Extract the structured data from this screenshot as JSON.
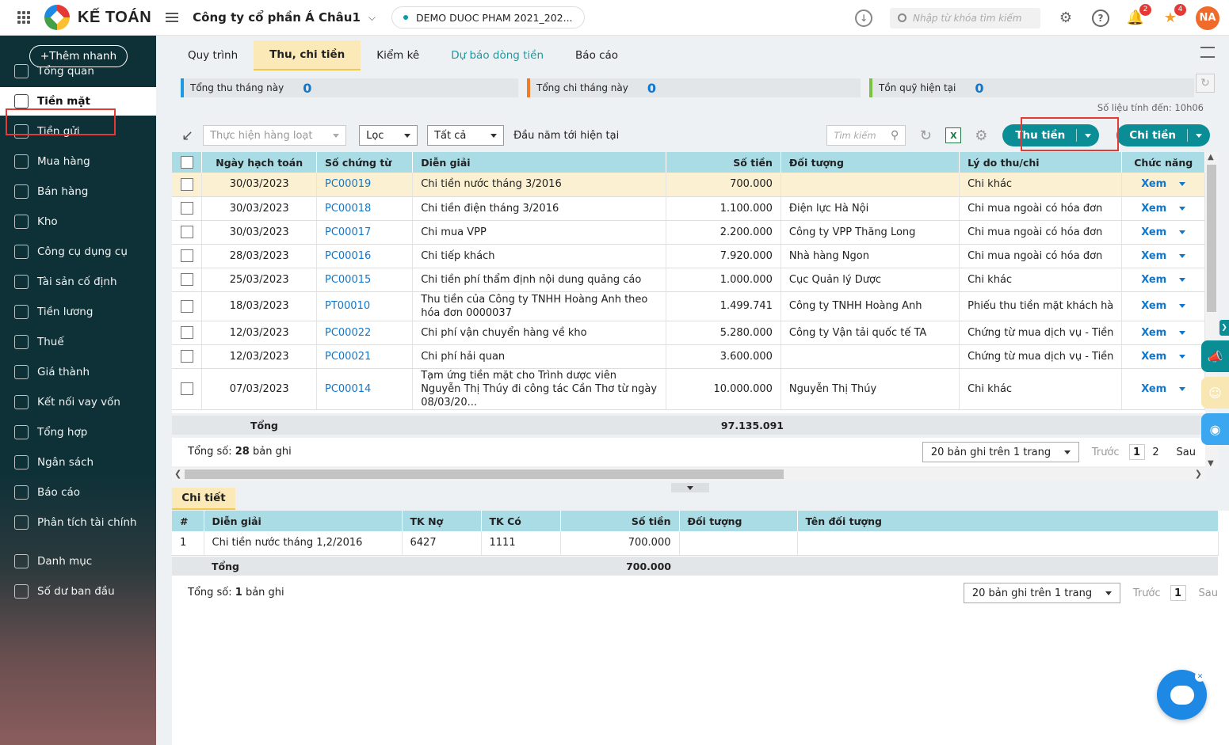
{
  "topbar": {
    "brand": "KẾ TOÁN",
    "company": "Công ty cổ phần Á Châu1",
    "database": "DEMO DUOC PHAM 2021_202...",
    "search_placeholder": "Nhập từ khóa tìm kiếm",
    "notif_count": "2",
    "alert_count": "4",
    "avatar": "NA"
  },
  "sidebar": {
    "quick_add": "Thêm nhanh",
    "items": [
      {
        "label": "Tổng quan",
        "icon": "dashboard-icon"
      },
      {
        "label": "Tiền mặt",
        "icon": "cash-bag-icon"
      },
      {
        "label": "Tiền gửi",
        "icon": "bank-icon"
      },
      {
        "label": "Mua hàng",
        "icon": "shopping-bag-icon"
      },
      {
        "label": "Bán hàng",
        "icon": "cart-icon"
      },
      {
        "label": "Kho",
        "icon": "warehouse-icon"
      },
      {
        "label": "Công cụ dụng cụ",
        "icon": "tools-icon"
      },
      {
        "label": "Tài sản cố định",
        "icon": "car-icon"
      },
      {
        "label": "Tiền lương",
        "icon": "payroll-icon"
      },
      {
        "label": "Thuế",
        "icon": "tax-building-icon"
      },
      {
        "label": "Giá thành",
        "icon": "price-tag-icon"
      },
      {
        "label": "Kết nối vay vốn",
        "icon": "loan-link-icon"
      },
      {
        "label": "Tổng hợp",
        "icon": "summary-icon"
      },
      {
        "label": "Ngân sách",
        "icon": "budget-icon"
      },
      {
        "label": "Báo cáo",
        "icon": "bar-chart-icon"
      },
      {
        "label": "Phân tích tài chính",
        "icon": "analytics-icon"
      },
      {
        "label": "Danh mục",
        "icon": "list-icon"
      },
      {
        "label": "Số dư ban đầu",
        "icon": "opening-balance-icon"
      }
    ]
  },
  "tabs": [
    "Quy trình",
    "Thu, chi tiền",
    "Kiểm kê",
    "Dự báo dòng tiền",
    "Báo cáo"
  ],
  "kpis": [
    {
      "label": "Tổng thu tháng này",
      "value": "0",
      "color": "#1e9be0"
    },
    {
      "label": "Tổng chi tháng này",
      "value": "0",
      "color": "#f07c2a"
    },
    {
      "label": "Tồn quỹ hiện tại",
      "value": "0",
      "color": "#7cc242"
    }
  ],
  "sync_text": "Số liệu tính đến: 10h06",
  "toolbar": {
    "batch": "Thực hiện hàng loạt",
    "filter": "Lọc",
    "scope": "Tất cả",
    "period": "Đầu năm tới hiện tại",
    "search_placeholder": "Tìm kiếm",
    "receive_btn": "Thu tiền",
    "pay_btn": "Chi tiền"
  },
  "table": {
    "headers": [
      "Ngày hạch toán",
      "Số chứng từ",
      "Diễn giải",
      "Số tiền",
      "Đối tượng",
      "Lý do thu/chi",
      "Chức năng"
    ],
    "rows": [
      {
        "date": "30/03/2023",
        "doc": "PC00019",
        "desc": "Chi tiền nước tháng 3/2016",
        "amount": "700.000",
        "party": "",
        "reason": "Chi khác",
        "action": "Xem"
      },
      {
        "date": "30/03/2023",
        "doc": "PC00018",
        "desc": "Chi tiền điện tháng 3/2016",
        "amount": "1.100.000",
        "party": "Điện lực Hà Nội",
        "reason": "Chi mua ngoài có hóa đơn",
        "action": "Xem"
      },
      {
        "date": "30/03/2023",
        "doc": "PC00017",
        "desc": "Chi mua VPP",
        "amount": "2.200.000",
        "party": "Công ty VPP Thăng Long",
        "reason": "Chi mua ngoài có hóa đơn",
        "action": "Xem"
      },
      {
        "date": "28/03/2023",
        "doc": "PC00016",
        "desc": "Chi tiếp khách",
        "amount": "7.920.000",
        "party": "Nhà hàng Ngon",
        "reason": "Chi mua ngoài có hóa đơn",
        "action": "Xem"
      },
      {
        "date": "25/03/2023",
        "doc": "PC00015",
        "desc": "Chi tiền phí thẩm định nội dung quảng cáo",
        "amount": "1.000.000",
        "party": "Cục Quản lý Dược",
        "reason": "Chi khác",
        "action": "Xem"
      },
      {
        "date": "18/03/2023",
        "doc": "PT00010",
        "desc": "Thu tiền của Công ty TNHH Hoàng Anh theo hóa đơn 0000037",
        "amount": "1.499.741",
        "party": "Công ty TNHH Hoàng Anh",
        "reason": "Phiếu thu tiền mặt khách hà",
        "action": "Xem"
      },
      {
        "date": "12/03/2023",
        "doc": "PC00022",
        "desc": "Chi phí vận chuyển hàng về kho",
        "amount": "5.280.000",
        "party": "Công ty Vận tải quốc tế TA",
        "reason": "Chứng từ mua dịch vụ - Tiền",
        "action": "Xem"
      },
      {
        "date": "12/03/2023",
        "doc": "PC00021",
        "desc": "Chi phí hải quan",
        "amount": "3.600.000",
        "party": "",
        "reason": "Chứng từ mua dịch vụ - Tiền",
        "action": "Xem"
      },
      {
        "date": "07/03/2023",
        "doc": "PC00014",
        "desc": "Tạm ứng tiền mặt cho Trình dược viên Nguyễn Thị Thúy đi công tác Cần Thơ từ ngày 08/03/20...",
        "amount": "10.000.000",
        "party": "Nguyễn Thị Thúy",
        "reason": "Chi khác",
        "action": "Xem"
      }
    ],
    "total_label": "Tổng",
    "total_amount": "97.135.091"
  },
  "pager": {
    "count_prefix": "Tổng số:",
    "count": "28",
    "count_suffix": "bản ghi",
    "page_size": "20 bản ghi trên 1 trang",
    "prev": "Trước",
    "page1": "1",
    "page2": "2",
    "next": "Sau"
  },
  "detail": {
    "tab": "Chi tiết",
    "headers": [
      "#",
      "Diễn giải",
      "TK Nợ",
      "TK Có",
      "Số tiền",
      "Đối tượng",
      "Tên đối tượng"
    ],
    "rows": [
      {
        "no": "1",
        "desc": "Chi tiền nước tháng 1,2/2016",
        "debit": "6427",
        "credit": "1111",
        "amount": "700.000",
        "party": "",
        "party_name": ""
      }
    ],
    "total_label": "Tổng",
    "total_amount": "700.000",
    "count_prefix": "Tổng số:",
    "count": "1",
    "count_suffix": "bản ghi",
    "page_size": "20 bản ghi trên 1 trang",
    "prev": "Trước",
    "page1": "1",
    "next": "Sau"
  }
}
